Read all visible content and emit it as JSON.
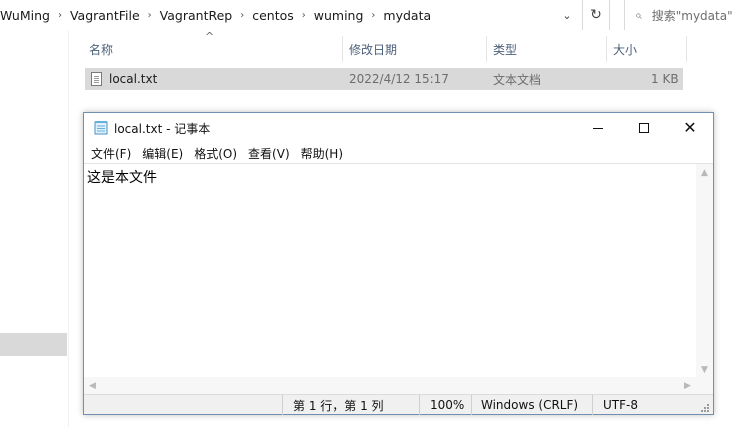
{
  "address_bar": {
    "crumbs": [
      "WuMing",
      "VagrantFile",
      "VagrantRep",
      "centos",
      "wuming",
      "mydata"
    ],
    "separator": "›",
    "dropdown_glyph": "⌄",
    "refresh_glyph": "↻",
    "search_placeholder": "搜索\"mydata\""
  },
  "file_list": {
    "columns": [
      "名称",
      "修改日期",
      "类型",
      "大小"
    ],
    "sort_indicator": "^",
    "rows": [
      {
        "name": "local.txt",
        "modified": "2022/4/12 15:17",
        "type": "文本文档",
        "size": "1 KB"
      }
    ]
  },
  "notepad": {
    "title": "local.txt - 记事本",
    "menu": [
      "文件(F)",
      "编辑(E)",
      "格式(O)",
      "查看(V)",
      "帮助(H)"
    ],
    "content": "这是本文件",
    "status": {
      "position": "第 1 行，第 1 列",
      "zoom": "100%",
      "line_ending": "Windows (CRLF)",
      "encoding": "UTF-8"
    },
    "close_glyph": "✕"
  },
  "colors": {
    "selection": "#d9d9d9",
    "header_text": "#4c607a",
    "window_border": "#6f8fb3"
  }
}
